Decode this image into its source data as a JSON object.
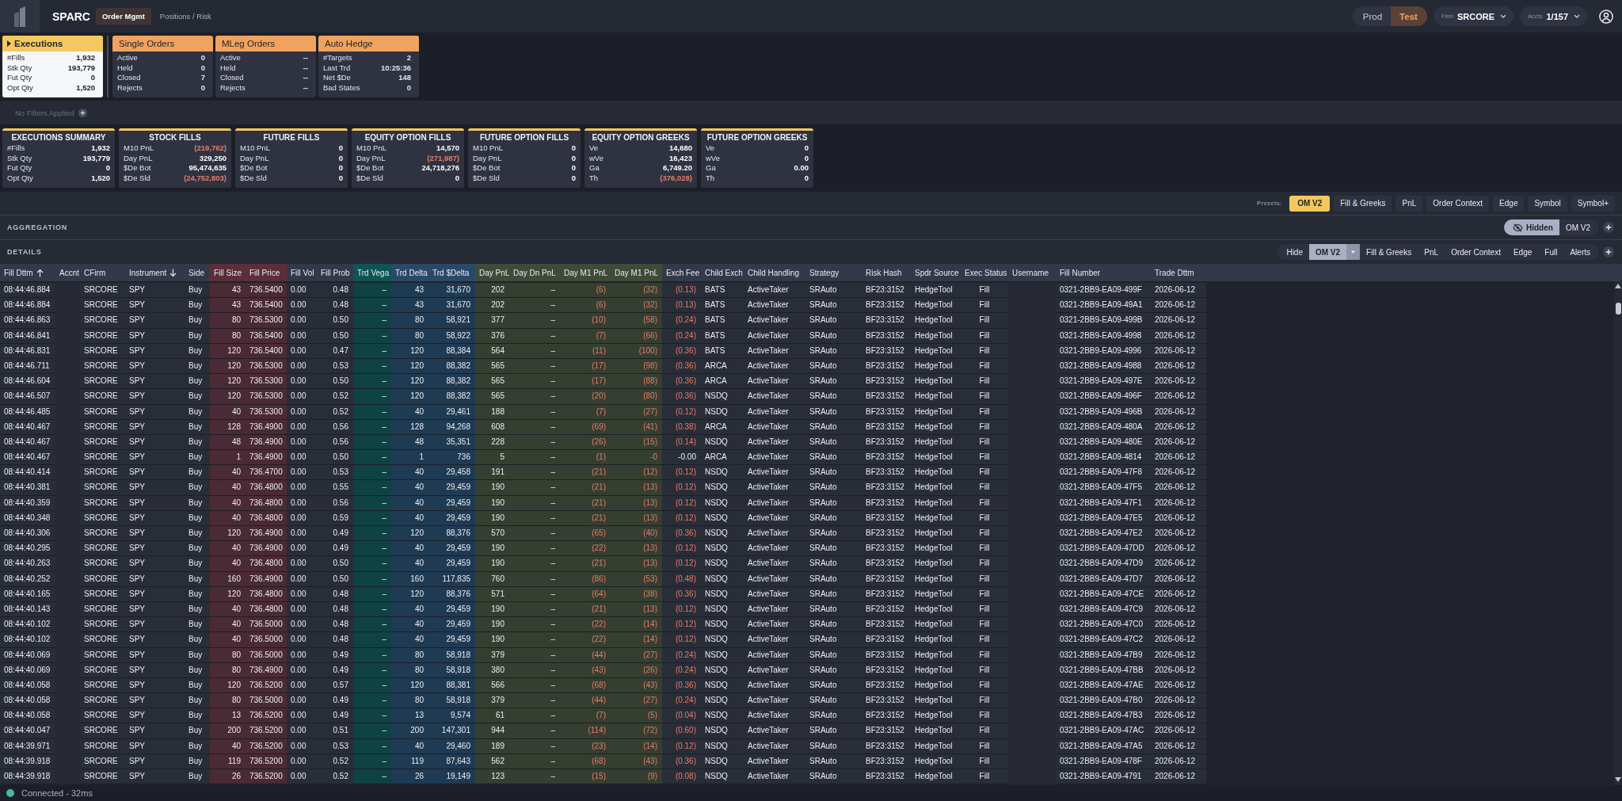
{
  "top_bar": {
    "app_name": "SPARC",
    "nav": [
      {
        "label": "Order Mgmt",
        "selected": true
      },
      {
        "label": "Positions / Risk",
        "selected": false
      }
    ],
    "environments": [
      {
        "label": "Prod",
        "selected": false
      },
      {
        "label": "Test",
        "selected": true
      }
    ],
    "firm": {
      "label": "Firm",
      "value": "SRCORE"
    },
    "accounts": {
      "label": "Accts",
      "value": "1/157"
    }
  },
  "order_cards": [
    {
      "title": "Executions",
      "selected": true,
      "rows": [
        {
          "label": "#Fills",
          "value": "1,932"
        },
        {
          "label": "Stk Qty",
          "value": "193,779"
        },
        {
          "label": "Fut Qty",
          "value": "0"
        },
        {
          "label": "Opt Qty",
          "value": "1,520"
        }
      ]
    },
    {
      "title": "Single Orders",
      "selected": false,
      "rows": [
        {
          "label": "Active",
          "value": "0"
        },
        {
          "label": "Held",
          "value": "0"
        },
        {
          "label": "Closed",
          "value": "7"
        },
        {
          "label": "Rejects",
          "value": "0"
        }
      ]
    },
    {
      "title": "MLeg Orders",
      "selected": false,
      "rows": [
        {
          "label": "Active",
          "value": "--"
        },
        {
          "label": "Held",
          "value": "--"
        },
        {
          "label": "Closed",
          "value": "--"
        },
        {
          "label": "Rejects",
          "value": "--"
        }
      ]
    },
    {
      "title": "Auto Hedge",
      "selected": false,
      "rows": [
        {
          "label": "#Targets",
          "value": "2"
        },
        {
          "label": "Last Trd",
          "value": "10:25:36"
        },
        {
          "label": "Net $De",
          "value": "148"
        },
        {
          "label": "Bad States",
          "value": "0"
        }
      ]
    }
  ],
  "filter_bar": {
    "text": "No Filters Applied"
  },
  "summary_cards": [
    {
      "title": "EXECUTIONS SUMMARY",
      "rows": [
        {
          "label": "#Fills",
          "value": "1,932",
          "loss": false
        },
        {
          "label": "Stk Qty",
          "value": "193,779",
          "loss": false
        },
        {
          "label": "Fut Qty",
          "value": "0",
          "loss": false
        },
        {
          "label": "Opt Qty",
          "value": "1,520",
          "loss": false
        }
      ]
    },
    {
      "title": "STOCK FILLS",
      "rows": [
        {
          "label": "M10 PnL",
          "value": "(219,762)",
          "loss": true
        },
        {
          "label": "Day PnL",
          "value": "329,250",
          "loss": false
        },
        {
          "label": "$De Bot",
          "value": "95,474,635",
          "loss": false
        },
        {
          "label": "$De Sld",
          "value": "(24,752,803)",
          "loss": true
        }
      ]
    },
    {
      "title": "FUTURE FILLS",
      "rows": [
        {
          "label": "M10 PnL",
          "value": "0",
          "loss": false
        },
        {
          "label": "Day PnL",
          "value": "0",
          "loss": false
        },
        {
          "label": "$De Bot",
          "value": "0",
          "loss": false
        },
        {
          "label": "$De Sld",
          "value": "0",
          "loss": false
        }
      ]
    },
    {
      "title": "EQUITY OPTION FILLS",
      "rows": [
        {
          "label": "M10 PnL",
          "value": "14,570",
          "loss": false
        },
        {
          "label": "Day PnL",
          "value": "(271,987)",
          "loss": true
        },
        {
          "label": "$De Bot",
          "value": "24,718,276",
          "loss": false
        },
        {
          "label": "$De Sld",
          "value": "0",
          "loss": false
        }
      ]
    },
    {
      "title": "FUTURE OPTION FILLS",
      "rows": [
        {
          "label": "M10 PnL",
          "value": "0",
          "loss": false
        },
        {
          "label": "Day PnL",
          "value": "0",
          "loss": false
        },
        {
          "label": "$De Bot",
          "value": "0",
          "loss": false
        },
        {
          "label": "$De Sld",
          "value": "0",
          "loss": false
        }
      ]
    },
    {
      "title": "EQUITY OPTION GREEKS",
      "rows": [
        {
          "label": "Ve",
          "value": "14,680",
          "loss": false
        },
        {
          "label": "wVe",
          "value": "16,423",
          "loss": false
        },
        {
          "label": "Ga",
          "value": "6,749.20",
          "loss": false
        },
        {
          "label": "Th",
          "value": "(376,028)",
          "loss": true
        }
      ]
    },
    {
      "title": "FUTURE OPTION GREEKS",
      "rows": [
        {
          "label": "Ve",
          "value": "0",
          "loss": false
        },
        {
          "label": "wVe",
          "value": "0",
          "loss": false
        },
        {
          "label": "Ga",
          "value": "0.00",
          "loss": false
        },
        {
          "label": "Th",
          "value": "0",
          "loss": false
        }
      ]
    }
  ],
  "presets": {
    "label": "Presets:",
    "buttons": [
      {
        "label": "OM V2",
        "selected": true
      },
      {
        "label": "Fill & Greeks",
        "selected": false
      },
      {
        "label": "PnL",
        "selected": false
      },
      {
        "label": "Order Context",
        "selected": false
      },
      {
        "label": "Edge",
        "selected": false
      },
      {
        "label": "Symbol",
        "selected": false
      },
      {
        "label": "Symbol+",
        "selected": false
      }
    ]
  },
  "aggregation": {
    "title": "AGGREGATION",
    "views": [
      {
        "label": "Hidden",
        "kind": "hidden",
        "selected": true
      },
      {
        "label": "OM V2",
        "kind": "view",
        "selected": false
      }
    ]
  },
  "details": {
    "title": "DETAILS",
    "views": [
      {
        "label": "Hide",
        "kind": "view",
        "selected": false
      },
      {
        "label": "OM V2",
        "kind": "dropdown",
        "selected": true
      },
      {
        "label": "Fill & Greeks",
        "kind": "view",
        "selected": false
      },
      {
        "label": "PnL",
        "kind": "view",
        "selected": false
      },
      {
        "label": "Order Context",
        "kind": "view",
        "selected": false
      },
      {
        "label": "Edge",
        "kind": "view",
        "selected": false
      },
      {
        "label": "Full",
        "kind": "view",
        "selected": false
      },
      {
        "label": "Alerts",
        "kind": "view",
        "selected": false
      }
    ]
  },
  "table": {
    "columns": [
      {
        "label": "Fill Dttm",
        "kind": "text",
        "sorted": true,
        "descending": false
      },
      {
        "label": "Accnt",
        "kind": "empty",
        "sorted": false
      },
      {
        "label": "CFirm",
        "kind": "text",
        "sorted": false
      },
      {
        "label": "Instrument",
        "kind": "text",
        "sorted": true,
        "descending": true
      },
      {
        "label": "Side",
        "kind": "text",
        "sorted": false
      },
      {
        "label": "Fill Size",
        "kind": "fill",
        "sorted": false
      },
      {
        "label": "Fill Price",
        "kind": "fill",
        "sorted": false
      },
      {
        "label": "Fill Vol",
        "kind": "text",
        "sorted": false
      },
      {
        "label": "Fill Prob",
        "kind": "number",
        "sorted": false
      },
      {
        "label": "Trd Vega",
        "kind": "vega",
        "sorted": false
      },
      {
        "label": "Trd Delta",
        "kind": "delta",
        "sorted": false
      },
      {
        "label": "Trd $Delta",
        "kind": "delta",
        "sorted": false
      },
      {
        "label": "Day PnL",
        "kind": "pnl",
        "sorted": false
      },
      {
        "label": "Day Dn PnL",
        "kind": "pnl",
        "sorted": false
      },
      {
        "label": "Day M1 PnL",
        "kind": "pnl",
        "sorted": false
      },
      {
        "label": "Day M1 PnL",
        "kind": "pnl",
        "sorted": false
      },
      {
        "label": "Exch Fee",
        "kind": "number",
        "sorted": false
      },
      {
        "label": "Child Exch",
        "kind": "text",
        "sorted": false
      },
      {
        "label": "Child Handling",
        "kind": "text",
        "sorted": false
      },
      {
        "label": "Strategy",
        "kind": "text",
        "sorted": false
      },
      {
        "label": "Risk Hash",
        "kind": "text",
        "sorted": false
      },
      {
        "label": "Spdr Source",
        "kind": "text",
        "sorted": false
      },
      {
        "label": "Exec Status",
        "kind": "status",
        "sorted": false
      },
      {
        "label": "Username",
        "kind": "empty",
        "sorted": false
      },
      {
        "label": "Fill Number",
        "kind": "text",
        "sorted": false
      },
      {
        "label": "Trade Dttm",
        "kind": "text",
        "sorted": false
      }
    ],
    "rows": [
      [
        "08:44:46.884",
        "",
        "SRCORE",
        "SPY",
        "Buy",
        "43",
        "736.5400",
        "0.00",
        "0.48",
        "–",
        "43",
        "31,670",
        "202",
        "–",
        {
          "text": "(6)",
          "loss": true
        },
        {
          "text": "(32)",
          "loss": true
        },
        {
          "text": "(0.13)",
          "loss": true
        },
        "BATS",
        "ActiveTaker",
        "SRAuto",
        "BF23:3152",
        "HedgeTool",
        "Fill",
        "",
        "0321-2BB9-EA09-499F",
        "2026-06-12"
      ],
      [
        "08:44:46.884",
        "",
        "SRCORE",
        "SPY",
        "Buy",
        "43",
        "736.5400",
        "0.00",
        "0.48",
        "–",
        "43",
        "31,670",
        "202",
        "–",
        {
          "text": "(6)",
          "loss": true
        },
        {
          "text": "(32)",
          "loss": true
        },
        {
          "text": "(0.13)",
          "loss": true
        },
        "BATS",
        "ActiveTaker",
        "SRAuto",
        "BF23:3152",
        "HedgeTool",
        "Fill",
        "",
        "0321-2BB9-EA09-49A1",
        "2026-06-12"
      ],
      [
        "08:44:46.863",
        "",
        "SRCORE",
        "SPY",
        "Buy",
        "80",
        "736.5300",
        "0.00",
        "0.50",
        "–",
        "80",
        "58,921",
        "377",
        "–",
        {
          "text": "(10)",
          "loss": true
        },
        {
          "text": "(58)",
          "loss": true
        },
        {
          "text": "(0.24)",
          "loss": true
        },
        "BATS",
        "ActiveTaker",
        "SRAuto",
        "BF23:3152",
        "HedgeTool",
        "Fill",
        "",
        "0321-2BB9-EA09-499B",
        "2026-06-12"
      ],
      [
        "08:44:46.841",
        "",
        "SRCORE",
        "SPY",
        "Buy",
        "80",
        "736.5400",
        "0.00",
        "0.50",
        "–",
        "80",
        "58,922",
        "376",
        "–",
        {
          "text": "(7)",
          "loss": true
        },
        {
          "text": "(66)",
          "loss": true
        },
        {
          "text": "(0.24)",
          "loss": true
        },
        "BATS",
        "ActiveTaker",
        "SRAuto",
        "BF23:3152",
        "HedgeTool",
        "Fill",
        "",
        "0321-2BB9-EA09-4998",
        "2026-06-12"
      ],
      [
        "08:44:46.831",
        "",
        "SRCORE",
        "SPY",
        "Buy",
        "120",
        "736.5400",
        "0.00",
        "0.47",
        "–",
        "120",
        "88,384",
        "564",
        "–",
        {
          "text": "(11)",
          "loss": true
        },
        {
          "text": "(100)",
          "loss": true
        },
        {
          "text": "(0.36)",
          "loss": true
        },
        "BATS",
        "ActiveTaker",
        "SRAuto",
        "BF23:3152",
        "HedgeTool",
        "Fill",
        "",
        "0321-2BB9-EA09-4996",
        "2026-06-12"
      ],
      [
        "08:44:46.711",
        "",
        "SRCORE",
        "SPY",
        "Buy",
        "120",
        "736.5300",
        "0.00",
        "0.53",
        "–",
        "120",
        "88,382",
        "565",
        "–",
        {
          "text": "(17)",
          "loss": true
        },
        {
          "text": "(98)",
          "loss": true
        },
        {
          "text": "(0.36)",
          "loss": true
        },
        "ARCA",
        "ActiveTaker",
        "SRAuto",
        "BF23:3152",
        "HedgeTool",
        "Fill",
        "",
        "0321-2BB9-EA09-4988",
        "2026-06-12"
      ],
      [
        "08:44:46.604",
        "",
        "SRCORE",
        "SPY",
        "Buy",
        "120",
        "736.5300",
        "0.00",
        "0.50",
        "–",
        "120",
        "88,382",
        "565",
        "–",
        {
          "text": "(17)",
          "loss": true
        },
        {
          "text": "(88)",
          "loss": true
        },
        {
          "text": "(0.36)",
          "loss": true
        },
        "ARCA",
        "ActiveTaker",
        "SRAuto",
        "BF23:3152",
        "HedgeTool",
        "Fill",
        "",
        "0321-2BB9-EA09-497E",
        "2026-06-12"
      ],
      [
        "08:44:46.507",
        "",
        "SRCORE",
        "SPY",
        "Buy",
        "120",
        "736.5300",
        "0.00",
        "0.52",
        "–",
        "120",
        "88,382",
        "565",
        "–",
        {
          "text": "(20)",
          "loss": true
        },
        {
          "text": "(80)",
          "loss": true
        },
        {
          "text": "(0.36)",
          "loss": true
        },
        "NSDQ",
        "ActiveTaker",
        "SRAuto",
        "BF23:3152",
        "HedgeTool",
        "Fill",
        "",
        "0321-2BB9-EA09-496F",
        "2026-06-12"
      ],
      [
        "08:44:46.485",
        "",
        "SRCORE",
        "SPY",
        "Buy",
        "40",
        "736.5300",
        "0.00",
        "0.52",
        "–",
        "40",
        "29,461",
        "188",
        "–",
        {
          "text": "(7)",
          "loss": true
        },
        {
          "text": "(27)",
          "loss": true
        },
        {
          "text": "(0.12)",
          "loss": true
        },
        "NSDQ",
        "ActiveTaker",
        "SRAuto",
        "BF23:3152",
        "HedgeTool",
        "Fill",
        "",
        "0321-2BB9-EA09-496B",
        "2026-06-12"
      ],
      [
        "08:44:40.467",
        "",
        "SRCORE",
        "SPY",
        "Buy",
        "128",
        "736.4900",
        "0.00",
        "0.56",
        "–",
        "128",
        "94,268",
        "608",
        "–",
        {
          "text": "(69)",
          "loss": true
        },
        {
          "text": "(41)",
          "loss": true
        },
        {
          "text": "(0.38)",
          "loss": true
        },
        "ARCA",
        "ActiveTaker",
        "SRAuto",
        "BF23:3152",
        "HedgeTool",
        "Fill",
        "",
        "0321-2BB9-EA09-480A",
        "2026-06-12"
      ],
      [
        "08:44:40.467",
        "",
        "SRCORE",
        "SPY",
        "Buy",
        "48",
        "736.4900",
        "0.00",
        "0.56",
        "–",
        "48",
        "35,351",
        "228",
        "–",
        {
          "text": "(26)",
          "loss": true
        },
        {
          "text": "(15)",
          "loss": true
        },
        {
          "text": "(0.14)",
          "loss": true
        },
        "NSDQ",
        "ActiveTaker",
        "SRAuto",
        "BF23:3152",
        "HedgeTool",
        "Fill",
        "",
        "0321-2BB9-EA09-480E",
        "2026-06-12"
      ],
      [
        "08:44:40.467",
        "",
        "SRCORE",
        "SPY",
        "Buy",
        "1",
        "736.4900",
        "0.00",
        "0.50",
        "–",
        "1",
        "736",
        "5",
        "–",
        {
          "text": "(1)",
          "loss": true
        },
        {
          "text": "-0",
          "loss": true
        },
        "-0.00",
        "ARCA",
        "ActiveTaker",
        "SRAuto",
        "BF23:3152",
        "HedgeTool",
        "Fill",
        "",
        "0321-2BB9-EA09-4814",
        "2026-06-12"
      ],
      [
        "08:44:40.414",
        "",
        "SRCORE",
        "SPY",
        "Buy",
        "40",
        "736.4700",
        "0.00",
        "0.53",
        "–",
        "40",
        "29,458",
        "191",
        "–",
        {
          "text": "(21)",
          "loss": true
        },
        {
          "text": "(12)",
          "loss": true
        },
        {
          "text": "(0.12)",
          "loss": true
        },
        "NSDQ",
        "ActiveTaker",
        "SRAuto",
        "BF23:3152",
        "HedgeTool",
        "Fill",
        "",
        "0321-2BB9-EA09-47F8",
        "2026-06-12"
      ],
      [
        "08:44:40.381",
        "",
        "SRCORE",
        "SPY",
        "Buy",
        "40",
        "736.4800",
        "0.00",
        "0.55",
        "–",
        "40",
        "29,459",
        "190",
        "–",
        {
          "text": "(21)",
          "loss": true
        },
        {
          "text": "(13)",
          "loss": true
        },
        {
          "text": "(0.12)",
          "loss": true
        },
        "NSDQ",
        "ActiveTaker",
        "SRAuto",
        "BF23:3152",
        "HedgeTool",
        "Fill",
        "",
        "0321-2BB9-EA09-47F5",
        "2026-06-12"
      ],
      [
        "08:44:40.359",
        "",
        "SRCORE",
        "SPY",
        "Buy",
        "40",
        "736.4800",
        "0.00",
        "0.56",
        "–",
        "40",
        "29,459",
        "190",
        "–",
        {
          "text": "(21)",
          "loss": true
        },
        {
          "text": "(13)",
          "loss": true
        },
        {
          "text": "(0.12)",
          "loss": true
        },
        "NSDQ",
        "ActiveTaker",
        "SRAuto",
        "BF23:3152",
        "HedgeTool",
        "Fill",
        "",
        "0321-2BB9-EA09-47F1",
        "2026-06-12"
      ],
      [
        "08:44:40.348",
        "",
        "SRCORE",
        "SPY",
        "Buy",
        "40",
        "736.4800",
        "0.00",
        "0.59",
        "–",
        "40",
        "29,459",
        "190",
        "–",
        {
          "text": "(21)",
          "loss": true
        },
        {
          "text": "(13)",
          "loss": true
        },
        {
          "text": "(0.12)",
          "loss": true
        },
        "NSDQ",
        "ActiveTaker",
        "SRAuto",
        "BF23:3152",
        "HedgeTool",
        "Fill",
        "",
        "0321-2BB9-EA09-47E5",
        "2026-06-12"
      ],
      [
        "08:44:40.306",
        "",
        "SRCORE",
        "SPY",
        "Buy",
        "120",
        "736.4900",
        "0.00",
        "0.49",
        "–",
        "120",
        "88,376",
        "570",
        "–",
        {
          "text": "(65)",
          "loss": true
        },
        {
          "text": "(40)",
          "loss": true
        },
        {
          "text": "(0.36)",
          "loss": true
        },
        "NSDQ",
        "ActiveTaker",
        "SRAuto",
        "BF23:3152",
        "HedgeTool",
        "Fill",
        "",
        "0321-2BB9-EA09-47E2",
        "2026-06-12"
      ],
      [
        "08:44:40.295",
        "",
        "SRCORE",
        "SPY",
        "Buy",
        "40",
        "736.4900",
        "0.00",
        "0.49",
        "–",
        "40",
        "29,459",
        "190",
        "–",
        {
          "text": "(22)",
          "loss": true
        },
        {
          "text": "(13)",
          "loss": true
        },
        {
          "text": "(0.12)",
          "loss": true
        },
        "NSDQ",
        "ActiveTaker",
        "SRAuto",
        "BF23:3152",
        "HedgeTool",
        "Fill",
        "",
        "0321-2BB9-EA09-47DD",
        "2026-06-12"
      ],
      [
        "08:44:40.263",
        "",
        "SRCORE",
        "SPY",
        "Buy",
        "40",
        "736.4800",
        "0.00",
        "0.50",
        "–",
        "40",
        "29,459",
        "190",
        "–",
        {
          "text": "(21)",
          "loss": true
        },
        {
          "text": "(13)",
          "loss": true
        },
        {
          "text": "(0.12)",
          "loss": true
        },
        "NSDQ",
        "ActiveTaker",
        "SRAuto",
        "BF23:3152",
        "HedgeTool",
        "Fill",
        "",
        "0321-2BB9-EA09-47D9",
        "2026-06-12"
      ],
      [
        "08:44:40.252",
        "",
        "SRCORE",
        "SPY",
        "Buy",
        "160",
        "736.4900",
        "0.00",
        "0.50",
        "–",
        "160",
        "117,835",
        "760",
        "–",
        {
          "text": "(86)",
          "loss": true
        },
        {
          "text": "(53)",
          "loss": true
        },
        {
          "text": "(0.48)",
          "loss": true
        },
        "NSDQ",
        "ActiveTaker",
        "SRAuto",
        "BF23:3152",
        "HedgeTool",
        "Fill",
        "",
        "0321-2BB9-EA09-47D7",
        "2026-06-12"
      ],
      [
        "08:44:40.165",
        "",
        "SRCORE",
        "SPY",
        "Buy",
        "120",
        "736.4800",
        "0.00",
        "0.48",
        "–",
        "120",
        "88,376",
        "571",
        "–",
        {
          "text": "(64)",
          "loss": true
        },
        {
          "text": "(38)",
          "loss": true
        },
        {
          "text": "(0.36)",
          "loss": true
        },
        "NSDQ",
        "ActiveTaker",
        "SRAuto",
        "BF23:3152",
        "HedgeTool",
        "Fill",
        "",
        "0321-2BB9-EA09-47CE",
        "2026-06-12"
      ],
      [
        "08:44:40.143",
        "",
        "SRCORE",
        "SPY",
        "Buy",
        "40",
        "736.4800",
        "0.00",
        "0.48",
        "–",
        "40",
        "29,459",
        "190",
        "–",
        {
          "text": "(21)",
          "loss": true
        },
        {
          "text": "(13)",
          "loss": true
        },
        {
          "text": "(0.12)",
          "loss": true
        },
        "NSDQ",
        "ActiveTaker",
        "SRAuto",
        "BF23:3152",
        "HedgeTool",
        "Fill",
        "",
        "0321-2BB9-EA09-47C9",
        "2026-06-12"
      ],
      [
        "08:44:40.102",
        "",
        "SRCORE",
        "SPY",
        "Buy",
        "40",
        "736.5000",
        "0.00",
        "0.48",
        "–",
        "40",
        "29,459",
        "190",
        "–",
        {
          "text": "(22)",
          "loss": true
        },
        {
          "text": "(14)",
          "loss": true
        },
        {
          "text": "(0.12)",
          "loss": true
        },
        "NSDQ",
        "ActiveTaker",
        "SRAuto",
        "BF23:3152",
        "HedgeTool",
        "Fill",
        "",
        "0321-2BB9-EA09-47C0",
        "2026-06-12"
      ],
      [
        "08:44:40.102",
        "",
        "SRCORE",
        "SPY",
        "Buy",
        "40",
        "736.5000",
        "0.00",
        "0.48",
        "–",
        "40",
        "29,459",
        "190",
        "–",
        {
          "text": "(22)",
          "loss": true
        },
        {
          "text": "(14)",
          "loss": true
        },
        {
          "text": "(0.12)",
          "loss": true
        },
        "NSDQ",
        "ActiveTaker",
        "SRAuto",
        "BF23:3152",
        "HedgeTool",
        "Fill",
        "",
        "0321-2BB9-EA09-47C2",
        "2026-06-12"
      ],
      [
        "08:44:40.069",
        "",
        "SRCORE",
        "SPY",
        "Buy",
        "80",
        "736.5000",
        "0.00",
        "0.49",
        "–",
        "80",
        "58,918",
        "379",
        "–",
        {
          "text": "(44)",
          "loss": true
        },
        {
          "text": "(27)",
          "loss": true
        },
        {
          "text": "(0.24)",
          "loss": true
        },
        "NSDQ",
        "ActiveTaker",
        "SRAuto",
        "BF23:3152",
        "HedgeTool",
        "Fill",
        "",
        "0321-2BB9-EA09-47B9",
        "2026-06-12"
      ],
      [
        "08:44:40.069",
        "",
        "SRCORE",
        "SPY",
        "Buy",
        "80",
        "736.4900",
        "0.00",
        "0.49",
        "–",
        "80",
        "58,918",
        "380",
        "–",
        {
          "text": "(43)",
          "loss": true
        },
        {
          "text": "(26)",
          "loss": true
        },
        {
          "text": "(0.24)",
          "loss": true
        },
        "NSDQ",
        "ActiveTaker",
        "SRAuto",
        "BF23:3152",
        "HedgeTool",
        "Fill",
        "",
        "0321-2BB9-EA09-47BB",
        "2026-06-12"
      ],
      [
        "08:44:40.058",
        "",
        "SRCORE",
        "SPY",
        "Buy",
        "120",
        "736.5200",
        "0.00",
        "0.57",
        "–",
        "120",
        "88,381",
        "566",
        "–",
        {
          "text": "(68)",
          "loss": true
        },
        {
          "text": "(43)",
          "loss": true
        },
        {
          "text": "(0.36)",
          "loss": true
        },
        "NSDQ",
        "ActiveTaker",
        "SRAuto",
        "BF23:3152",
        "HedgeTool",
        "Fill",
        "",
        "0321-2BB9-EA09-47AE",
        "2026-06-12"
      ],
      [
        "08:44:40.058",
        "",
        "SRCORE",
        "SPY",
        "Buy",
        "80",
        "736.5000",
        "0.00",
        "0.49",
        "–",
        "80",
        "58,918",
        "379",
        "–",
        {
          "text": "(44)",
          "loss": true
        },
        {
          "text": "(27)",
          "loss": true
        },
        {
          "text": "(0.24)",
          "loss": true
        },
        "NSDQ",
        "ActiveTaker",
        "SRAuto",
        "BF23:3152",
        "HedgeTool",
        "Fill",
        "",
        "0321-2BB9-EA09-47B0",
        "2026-06-12"
      ],
      [
        "08:44:40.058",
        "",
        "SRCORE",
        "SPY",
        "Buy",
        "13",
        "736.5200",
        "0.00",
        "0.49",
        "–",
        "13",
        "9,574",
        "61",
        "–",
        {
          "text": "(7)",
          "loss": true
        },
        {
          "text": "(5)",
          "loss": true
        },
        {
          "text": "(0.04)",
          "loss": true
        },
        "NSDQ",
        "ActiveTaker",
        "SRAuto",
        "BF23:3152",
        "HedgeTool",
        "Fill",
        "",
        "0321-2BB9-EA09-47B3",
        "2026-06-12"
      ],
      [
        "08:44:40.047",
        "",
        "SRCORE",
        "SPY",
        "Buy",
        "200",
        "736.5200",
        "0.00",
        "0.51",
        "–",
        "200",
        "147,301",
        "944",
        "–",
        {
          "text": "(114)",
          "loss": true
        },
        {
          "text": "(72)",
          "loss": true
        },
        {
          "text": "(0.60)",
          "loss": true
        },
        "NSDQ",
        "ActiveTaker",
        "SRAuto",
        "BF23:3152",
        "HedgeTool",
        "Fill",
        "",
        "0321-2BB9-EA09-47AC",
        "2026-06-12"
      ],
      [
        "08:44:39.971",
        "",
        "SRCORE",
        "SPY",
        "Buy",
        "40",
        "736.5200",
        "0.00",
        "0.53",
        "–",
        "40",
        "29,460",
        "189",
        "–",
        {
          "text": "(23)",
          "loss": true
        },
        {
          "text": "(14)",
          "loss": true
        },
        {
          "text": "(0.12)",
          "loss": true
        },
        "NSDQ",
        "ActiveTaker",
        "SRAuto",
        "BF23:3152",
        "HedgeTool",
        "Fill",
        "",
        "0321-2BB9-EA09-47A5",
        "2026-06-12"
      ],
      [
        "08:44:39.918",
        "",
        "SRCORE",
        "SPY",
        "Buy",
        "119",
        "736.5200",
        "0.00",
        "0.52",
        "–",
        "119",
        "87,643",
        "562",
        "–",
        {
          "text": "(68)",
          "loss": true
        },
        {
          "text": "(43)",
          "loss": true
        },
        {
          "text": "(0.36)",
          "loss": true
        },
        "NSDQ",
        "ActiveTaker",
        "SRAuto",
        "BF23:3152",
        "HedgeTool",
        "Fill",
        "",
        "0321-2BB9-EA09-478F",
        "2026-06-12"
      ],
      [
        "08:44:39.918",
        "",
        "SRCORE",
        "SPY",
        "Buy",
        "26",
        "736.5200",
        "0.00",
        "0.52",
        "–",
        "26",
        "19,149",
        "123",
        "–",
        {
          "text": "(15)",
          "loss": true
        },
        {
          "text": "(9)",
          "loss": true
        },
        {
          "text": "(0.08)",
          "loss": true
        },
        "NSDQ",
        "ActiveTaker",
        "SRAuto",
        "BF23:3152",
        "HedgeTool",
        "Fill",
        "",
        "0321-2BB9-EA09-4791",
        "2026-06-12"
      ]
    ]
  },
  "status_bar": {
    "text": "Connected - 32ms",
    "connected": true
  }
}
